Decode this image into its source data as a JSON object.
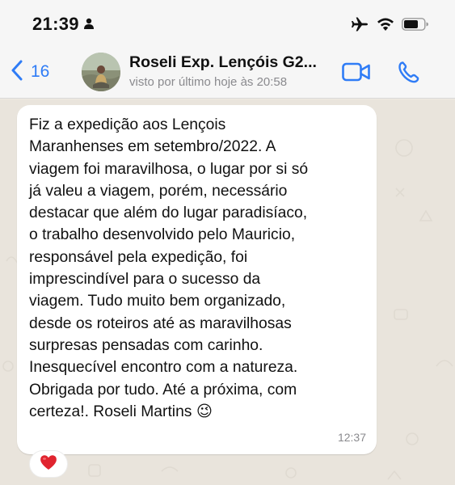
{
  "status_bar": {
    "time": "21:39"
  },
  "header": {
    "back_count": "16",
    "contact_name": "Roseli Exp. Lençóis G2...",
    "last_seen": "visto por último hoje às 20:58",
    "accent_color": "#2f7cf6"
  },
  "message": {
    "text": "Fiz a expedição aos Lençois\nMaranhenses em setembro/2022. A\nviagem foi maravilhosa, o lugar por si só\njá valeu a viagem, porém, necessário\ndestacar que além do lugar paradisíaco,\no trabalho desenvolvido pelo Mauricio,\nresponsável pela expedição, foi\nimprescindível para o sucesso da\nviagem. Tudo muito bem organizado,\ndesde os roteiros até  as maravilhosas\nsurpresas pensadas com carinho.\nInesquecível encontro com a natureza.\nObrigada  por tudo. Até a próxima, com\ncerteza!. Roseli Martins",
    "emoji": "😉",
    "time": "12:37",
    "reaction": "❤️"
  },
  "icons": {
    "person": "person-icon",
    "airplane": "airplane-icon",
    "wifi": "wifi-icon",
    "battery": "battery-icon",
    "back": "chevron-left-icon",
    "video": "video-camera-icon",
    "phone": "phone-icon",
    "heart": "heart-icon",
    "wink": "wink-emoji-icon"
  }
}
